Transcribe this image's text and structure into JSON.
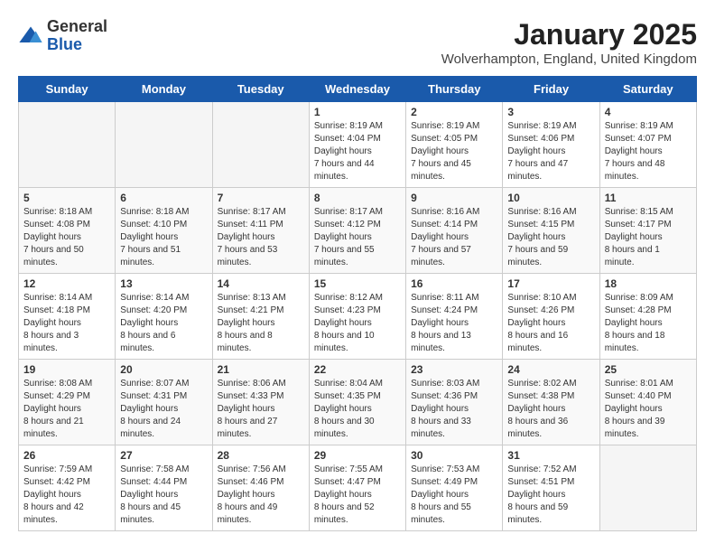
{
  "logo": {
    "general": "General",
    "blue": "Blue"
  },
  "title": {
    "month": "January 2025",
    "location": "Wolverhampton, England, United Kingdom"
  },
  "weekdays": [
    "Sunday",
    "Monday",
    "Tuesday",
    "Wednesday",
    "Thursday",
    "Friday",
    "Saturday"
  ],
  "weeks": [
    [
      {
        "day": "",
        "empty": true
      },
      {
        "day": "",
        "empty": true
      },
      {
        "day": "",
        "empty": true
      },
      {
        "day": "1",
        "sunrise": "8:19 AM",
        "sunset": "4:04 PM",
        "daylight": "7 hours and 44 minutes."
      },
      {
        "day": "2",
        "sunrise": "8:19 AM",
        "sunset": "4:05 PM",
        "daylight": "7 hours and 45 minutes."
      },
      {
        "day": "3",
        "sunrise": "8:19 AM",
        "sunset": "4:06 PM",
        "daylight": "7 hours and 47 minutes."
      },
      {
        "day": "4",
        "sunrise": "8:19 AM",
        "sunset": "4:07 PM",
        "daylight": "7 hours and 48 minutes."
      }
    ],
    [
      {
        "day": "5",
        "sunrise": "8:18 AM",
        "sunset": "4:08 PM",
        "daylight": "7 hours and 50 minutes."
      },
      {
        "day": "6",
        "sunrise": "8:18 AM",
        "sunset": "4:10 PM",
        "daylight": "7 hours and 51 minutes."
      },
      {
        "day": "7",
        "sunrise": "8:17 AM",
        "sunset": "4:11 PM",
        "daylight": "7 hours and 53 minutes."
      },
      {
        "day": "8",
        "sunrise": "8:17 AM",
        "sunset": "4:12 PM",
        "daylight": "7 hours and 55 minutes."
      },
      {
        "day": "9",
        "sunrise": "8:16 AM",
        "sunset": "4:14 PM",
        "daylight": "7 hours and 57 minutes."
      },
      {
        "day": "10",
        "sunrise": "8:16 AM",
        "sunset": "4:15 PM",
        "daylight": "7 hours and 59 minutes."
      },
      {
        "day": "11",
        "sunrise": "8:15 AM",
        "sunset": "4:17 PM",
        "daylight": "8 hours and 1 minute."
      }
    ],
    [
      {
        "day": "12",
        "sunrise": "8:14 AM",
        "sunset": "4:18 PM",
        "daylight": "8 hours and 3 minutes."
      },
      {
        "day": "13",
        "sunrise": "8:14 AM",
        "sunset": "4:20 PM",
        "daylight": "8 hours and 6 minutes."
      },
      {
        "day": "14",
        "sunrise": "8:13 AM",
        "sunset": "4:21 PM",
        "daylight": "8 hours and 8 minutes."
      },
      {
        "day": "15",
        "sunrise": "8:12 AM",
        "sunset": "4:23 PM",
        "daylight": "8 hours and 10 minutes."
      },
      {
        "day": "16",
        "sunrise": "8:11 AM",
        "sunset": "4:24 PM",
        "daylight": "8 hours and 13 minutes."
      },
      {
        "day": "17",
        "sunrise": "8:10 AM",
        "sunset": "4:26 PM",
        "daylight": "8 hours and 16 minutes."
      },
      {
        "day": "18",
        "sunrise": "8:09 AM",
        "sunset": "4:28 PM",
        "daylight": "8 hours and 18 minutes."
      }
    ],
    [
      {
        "day": "19",
        "sunrise": "8:08 AM",
        "sunset": "4:29 PM",
        "daylight": "8 hours and 21 minutes."
      },
      {
        "day": "20",
        "sunrise": "8:07 AM",
        "sunset": "4:31 PM",
        "daylight": "8 hours and 24 minutes."
      },
      {
        "day": "21",
        "sunrise": "8:06 AM",
        "sunset": "4:33 PM",
        "daylight": "8 hours and 27 minutes."
      },
      {
        "day": "22",
        "sunrise": "8:04 AM",
        "sunset": "4:35 PM",
        "daylight": "8 hours and 30 minutes."
      },
      {
        "day": "23",
        "sunrise": "8:03 AM",
        "sunset": "4:36 PM",
        "daylight": "8 hours and 33 minutes."
      },
      {
        "day": "24",
        "sunrise": "8:02 AM",
        "sunset": "4:38 PM",
        "daylight": "8 hours and 36 minutes."
      },
      {
        "day": "25",
        "sunrise": "8:01 AM",
        "sunset": "4:40 PM",
        "daylight": "8 hours and 39 minutes."
      }
    ],
    [
      {
        "day": "26",
        "sunrise": "7:59 AM",
        "sunset": "4:42 PM",
        "daylight": "8 hours and 42 minutes."
      },
      {
        "day": "27",
        "sunrise": "7:58 AM",
        "sunset": "4:44 PM",
        "daylight": "8 hours and 45 minutes."
      },
      {
        "day": "28",
        "sunrise": "7:56 AM",
        "sunset": "4:46 PM",
        "daylight": "8 hours and 49 minutes."
      },
      {
        "day": "29",
        "sunrise": "7:55 AM",
        "sunset": "4:47 PM",
        "daylight": "8 hours and 52 minutes."
      },
      {
        "day": "30",
        "sunrise": "7:53 AM",
        "sunset": "4:49 PM",
        "daylight": "8 hours and 55 minutes."
      },
      {
        "day": "31",
        "sunrise": "7:52 AM",
        "sunset": "4:51 PM",
        "daylight": "8 hours and 59 minutes."
      },
      {
        "day": "",
        "empty": true
      }
    ]
  ],
  "labels": {
    "sunrise": "Sunrise:",
    "sunset": "Sunset:",
    "daylight": "Daylight hours"
  }
}
